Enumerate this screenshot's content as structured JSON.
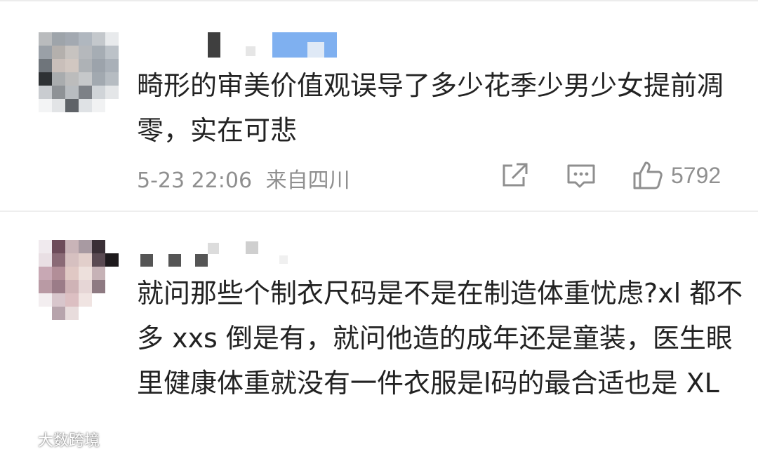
{
  "comments": [
    {
      "text": "畸形的审美价值观误导了多少花季少男少女提前凋零，实在可悲",
      "timestamp": "5-23 22:06",
      "location": "来自四川",
      "like_count": "5792",
      "avatar": "pixelated-avatar",
      "username": "pixelated-username"
    },
    {
      "text": "就问那些个制衣尺码是不是在制造体重忧虑?xl 都不多 xxs 倒是有，就问他造的成年还是童装，医生眼里健康体重就没有一件衣服是l码的最合适也是 XL",
      "avatar": "pixelated-avatar",
      "username": "pixelated-username"
    }
  ],
  "icons": {
    "share": "share-icon",
    "comment": "comment-icon",
    "like": "thumbs-up-icon",
    "watermark": "weibo-logo-icon"
  },
  "watermark": {
    "text": "大数跨境"
  },
  "colors": {
    "meta_text": "#8f8f8f",
    "body_text": "#222222",
    "divider": "#eeeeee"
  }
}
